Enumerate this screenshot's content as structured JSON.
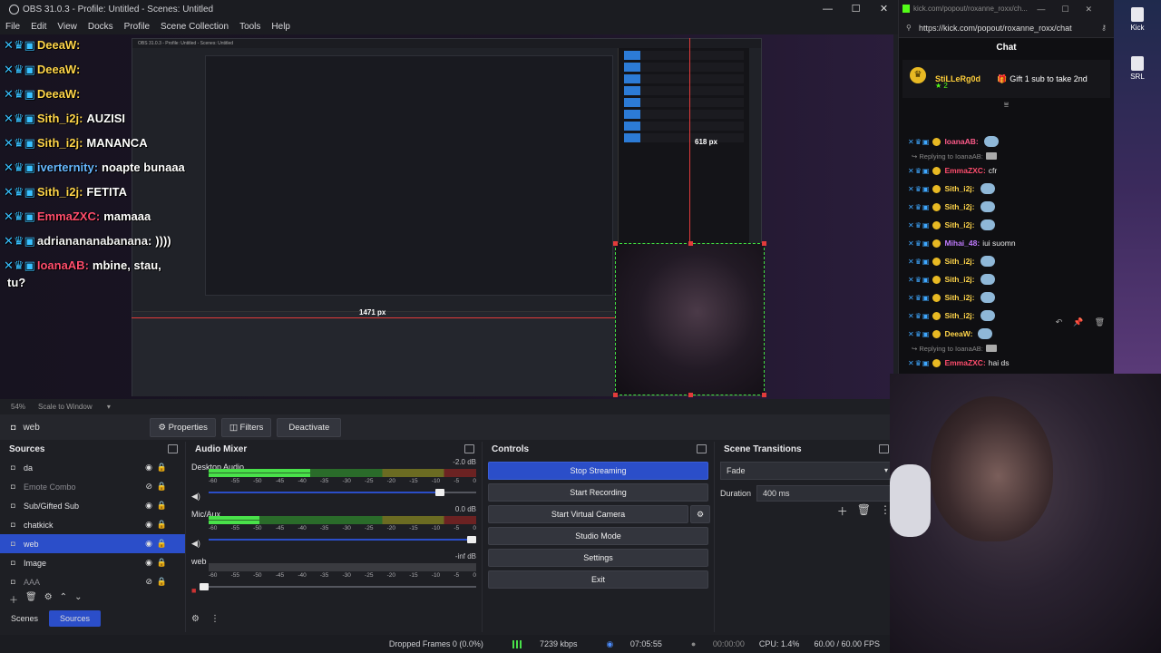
{
  "obs": {
    "title": "OBS 31.0.3 - Profile: Untitled - Scenes: Untitled",
    "menu": [
      "File",
      "Edit",
      "View",
      "Docks",
      "Profile",
      "Scene Collection",
      "Tools",
      "Help"
    ],
    "window_controls": [
      "—",
      "☐",
      "✕"
    ],
    "preview": {
      "overlay_chat": [
        {
          "name": "DeeaW:",
          "name_color": "gold",
          "msg": ""
        },
        {
          "name": "DeeaW:",
          "name_color": "gold",
          "msg": ""
        },
        {
          "name": "DeeaW:",
          "name_color": "gold",
          "msg": ""
        },
        {
          "name": "Sith_i2j:",
          "name_color": "gold",
          "msg": "AUZISI"
        },
        {
          "name": "Sith_i2j:",
          "name_color": "gold",
          "msg": "MANANCA"
        },
        {
          "name": "iverternity:",
          "name_color": "blue",
          "msg": "noapte bunaaa"
        },
        {
          "name": "Sith_i2j:",
          "name_color": "gold",
          "msg": "FETITA"
        },
        {
          "name": "EmmaZXC:",
          "name_color": "pink",
          "msg": "mamaaa"
        },
        {
          "name": "adrianananabanana:",
          "name_color": "white",
          "msg": "))))"
        },
        {
          "name": "IoanaAB:",
          "name_color": "pink",
          "msg": "mbine, stau,"
        },
        {
          "name": "",
          "name_color": "white",
          "msg": "tu?"
        }
      ],
      "size_label_width": "1471 px",
      "size_label_height": "618 px",
      "nested_title": "OBS 31.0.3 - Profile: Untitled - Scenes: Untitled"
    },
    "zoom": "54%",
    "scale_mode": "Scale to Window",
    "selected_source": "web",
    "source_toolbar": {
      "properties": "Properties",
      "filters": "Filters",
      "deactivate": "Deactivate"
    },
    "docks": {
      "sources": {
        "title": "Sources",
        "items": [
          {
            "label": "da",
            "selected": false,
            "hidden": false
          },
          {
            "label": "Emote Combo",
            "selected": false,
            "hidden": true
          },
          {
            "label": "Sub/Gifted Sub",
            "selected": false,
            "hidden": false
          },
          {
            "label": "chatkick",
            "selected": false,
            "hidden": false
          },
          {
            "label": "web",
            "selected": true,
            "hidden": false
          },
          {
            "label": "Image",
            "selected": false,
            "hidden": false
          },
          {
            "label": "AAA",
            "selected": false,
            "hidden": true
          }
        ],
        "tabs": [
          "Scenes",
          "Sources"
        ]
      },
      "mixer": {
        "title": "Audio Mixer",
        "ticks": [
          "-60",
          "-55",
          "-50",
          "-45",
          "-40",
          "-35",
          "-30",
          "-25",
          "-20",
          "-15",
          "-10",
          "-5",
          "0"
        ],
        "channels": [
          {
            "name": "Desktop Audio",
            "db": "-2.0 dB",
            "level": 0.38,
            "volume": 0.88
          },
          {
            "name": "Mic/Aux",
            "db": "0.0 dB",
            "level": 0.19,
            "volume": 1.0
          },
          {
            "name": "web",
            "db": "-inf dB",
            "level": 0.0,
            "volume": 0.0
          }
        ]
      },
      "controls": {
        "title": "Controls",
        "buttons": [
          "Stop Streaming",
          "Start Recording",
          "Start Virtual Camera",
          "Studio Mode",
          "Settings",
          "Exit"
        ]
      },
      "transitions": {
        "title": "Scene Transitions",
        "transition": "Fade",
        "duration_label": "Duration",
        "duration": "400 ms"
      }
    },
    "statusbar": {
      "dropped": "Dropped Frames 0 (0.0%)",
      "bitrate": "7239 kbps",
      "live_time": "07:05:55",
      "rec_time": "00:00:00",
      "cpu": "CPU: 1.4%",
      "fps": "60.00 / 60.00 FPS"
    }
  },
  "browser": {
    "title": "kick.com/popout/roxanne_roxx/ch...",
    "url": "https://kick.com/popout/roxanne_roxx/chat",
    "chat_title": "Chat",
    "pinned": {
      "user": "StiLLeRg0d",
      "count": "2",
      "text": "Gift 1 sub to take 2nd"
    },
    "messages": [
      {
        "type": "msg",
        "name": "IoanaAB:",
        "color": "#ff5b8a",
        "text": ""
      },
      {
        "type": "reply",
        "text": "Replying to IoanaAB:"
      },
      {
        "type": "msg",
        "name": "EmmaZXC:",
        "color": "#ff4d6d",
        "text": "cfr"
      },
      {
        "type": "msg",
        "name": "Sith_i2j:",
        "color": "#ffd54a",
        "text": ""
      },
      {
        "type": "msg",
        "name": "Sith_i2j:",
        "color": "#ffd54a",
        "text": ""
      },
      {
        "type": "msg",
        "name": "Sith_i2j:",
        "color": "#ffd54a",
        "text": ""
      },
      {
        "type": "msg",
        "name": "Mihai_48:",
        "color": "#c07bff",
        "text": "iui suomn"
      },
      {
        "type": "msg",
        "name": "Sith_i2j:",
        "color": "#ffd54a",
        "text": ""
      },
      {
        "type": "msg",
        "name": "Sith_i2j:",
        "color": "#ffd54a",
        "text": ""
      },
      {
        "type": "msg",
        "name": "Sith_i2j:",
        "color": "#ffd54a",
        "text": ""
      },
      {
        "type": "msg",
        "name": "Sith_i2j:",
        "color": "#ffd54a",
        "text": ""
      },
      {
        "type": "msg",
        "name": "DeeaW:",
        "color": "#ffd54a",
        "text": ""
      },
      {
        "type": "reply",
        "text": "Replying to IoanaAB:"
      },
      {
        "type": "msg",
        "name": "EmmaZXC:",
        "color": "#ff4d6d",
        "text": "hai ds"
      }
    ]
  },
  "taskbar": [
    {
      "label": "Kick"
    },
    {
      "label": "SRL"
    }
  ]
}
